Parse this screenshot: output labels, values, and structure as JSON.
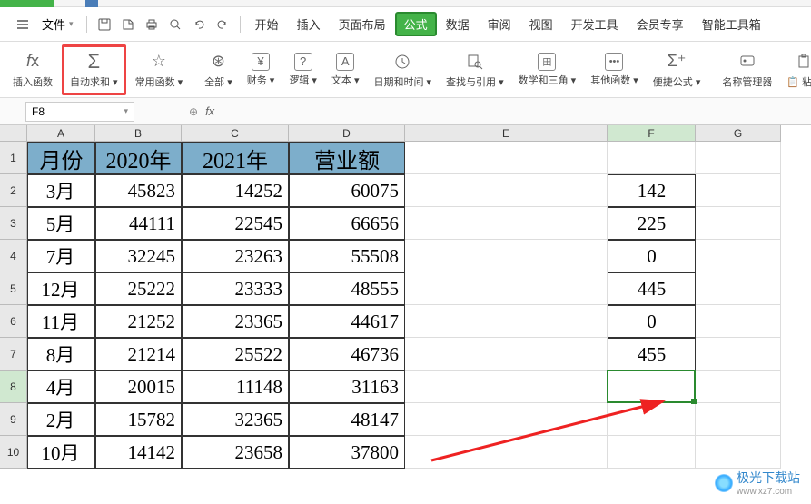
{
  "tabs_top": {
    "active_color": "#44b349"
  },
  "file_menu": {
    "label": "文件",
    "dropdown": "▾"
  },
  "menu": {
    "start": "开始",
    "insert": "插入",
    "layout": "页面布局",
    "formula": "公式",
    "data": "数据",
    "review": "审阅",
    "view": "视图",
    "dev": "开发工具",
    "member": "会员专享",
    "smart": "智能工具箱"
  },
  "ribbon": {
    "insert_fn": "插入函数",
    "autosum": "自动求和",
    "common": "常用函数",
    "all": "全部",
    "finance": "财务",
    "logic": "逻辑",
    "text": "文本",
    "datetime": "日期和时间",
    "lookup": "查找与引用",
    "math": "数学和三角",
    "other": "其他函数",
    "quick": "便捷公式",
    "name_mgr": "名称管理器",
    "paste": "粘贴"
  },
  "formula_bar": {
    "cell_ref": "F8",
    "fx": "fx"
  },
  "cols": [
    "A",
    "B",
    "C",
    "D",
    "E",
    "F",
    "G"
  ],
  "headers": {
    "a": "月份",
    "b": "2020年",
    "c": "2021年",
    "d": "营业额"
  },
  "rows": [
    {
      "m": "3月",
      "y20": "45823",
      "y21": "14252",
      "amt": "60075",
      "f": "142"
    },
    {
      "m": "5月",
      "y20": "44111",
      "y21": "22545",
      "amt": "66656",
      "f": "225"
    },
    {
      "m": "7月",
      "y20": "32245",
      "y21": "23263",
      "amt": "55508",
      "f": "0"
    },
    {
      "m": "12月",
      "y20": "25222",
      "y21": "23333",
      "amt": "48555",
      "f": "445"
    },
    {
      "m": "11月",
      "y20": "21252",
      "y21": "23365",
      "amt": "44617",
      "f": "0"
    },
    {
      "m": "8月",
      "y20": "21214",
      "y21": "25522",
      "amt": "46736",
      "f": "455"
    },
    {
      "m": "4月",
      "y20": "20015",
      "y21": "11148",
      "amt": "31163",
      "f": ""
    },
    {
      "m": "2月",
      "y20": "15782",
      "y21": "32365",
      "amt": "48147",
      "f": ""
    },
    {
      "m": "10月",
      "y20": "14142",
      "y21": "23658",
      "amt": "37800",
      "f": ""
    }
  ],
  "watermark": {
    "brand": "极光下载站",
    "url": "www.xz7.com"
  }
}
